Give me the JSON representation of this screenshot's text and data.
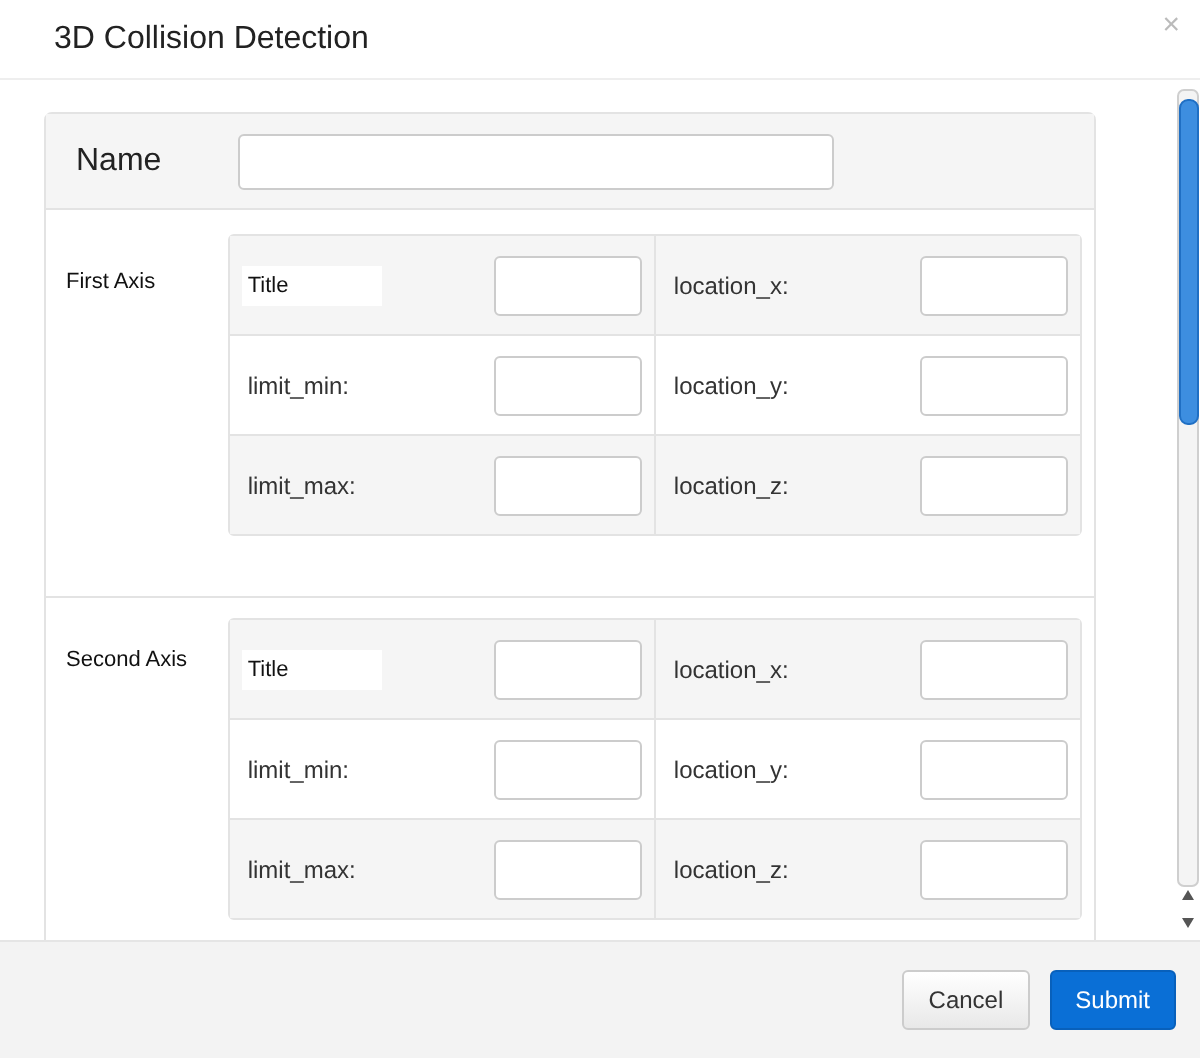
{
  "dialog": {
    "title": "3D Collision Detection",
    "close": "×"
  },
  "name_field": {
    "label": "Name"
  },
  "axes": [
    {
      "label": "First Axis",
      "rows": [
        {
          "left": "Title",
          "right": "location_x:"
        },
        {
          "left": "limit_min:",
          "right": "location_y:"
        },
        {
          "left": "limit_max:",
          "right": "location_z:"
        }
      ]
    },
    {
      "label": "Second Axis",
      "rows": [
        {
          "left": "Title",
          "right": "location_x:"
        },
        {
          "left": "limit_min:",
          "right": "location_y:"
        },
        {
          "left": "limit_max:",
          "right": "location_z:"
        }
      ]
    }
  ],
  "buttons": [
    {
      "label": "Cancel",
      "kind": "secondary"
    },
    {
      "label": "Submit",
      "kind": "primary"
    }
  ]
}
